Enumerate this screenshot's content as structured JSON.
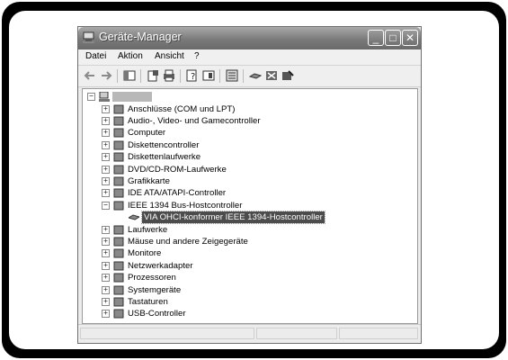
{
  "window": {
    "title": "Geräte-Manager",
    "buttons": {
      "minimize": "_",
      "maximize": "□",
      "close": "✕"
    }
  },
  "menu": [
    {
      "label": "Datei"
    },
    {
      "label": "Aktion"
    },
    {
      "label": "Ansicht"
    },
    {
      "label": "?"
    }
  ],
  "toolbar": {
    "icons": [
      "back-arrow-icon",
      "forward-arrow-icon",
      "console-tree-icon",
      "properties-icon",
      "print-icon",
      "help-icon",
      "view-icon",
      "scan-hardware-icon",
      "update-driver-icon",
      "uninstall-icon",
      "disable-icon"
    ]
  },
  "tree": {
    "root": {
      "label": ""
    },
    "categories": [
      {
        "label": "Anschlüsse (COM und LPT)",
        "icon": "port-icon",
        "expanded": false
      },
      {
        "label": "Audio-, Video- und Gamecontroller",
        "icon": "audio-icon",
        "expanded": false
      },
      {
        "label": "Computer",
        "icon": "computer-icon",
        "expanded": false
      },
      {
        "label": "Diskettencontroller",
        "icon": "floppy-controller-icon",
        "expanded": false
      },
      {
        "label": "Diskettenlaufwerke",
        "icon": "floppy-drive-icon",
        "expanded": false
      },
      {
        "label": "DVD/CD-ROM-Laufwerke",
        "icon": "cdrom-icon",
        "expanded": false
      },
      {
        "label": "Grafikkarte",
        "icon": "display-adapter-icon",
        "expanded": false
      },
      {
        "label": "IDE ATA/ATAPI-Controller",
        "icon": "ide-controller-icon",
        "expanded": false
      },
      {
        "label": "IEEE 1394 Bus-Hostcontroller",
        "icon": "ieee1394-icon",
        "expanded": true,
        "children": [
          {
            "label": "VIA OHCI-konformer IEEE 1394-Hostcontroller",
            "icon": "ieee1394-device-icon",
            "selected": true
          }
        ]
      },
      {
        "label": "Laufwerke",
        "icon": "disk-drive-icon",
        "expanded": false
      },
      {
        "label": "Mäuse und andere Zeigegeräte",
        "icon": "mouse-icon",
        "expanded": false
      },
      {
        "label": "Monitore",
        "icon": "monitor-icon",
        "expanded": false
      },
      {
        "label": "Netzwerkadapter",
        "icon": "network-adapter-icon",
        "expanded": false
      },
      {
        "label": "Prozessoren",
        "icon": "processor-icon",
        "expanded": false
      },
      {
        "label": "Systemgeräte",
        "icon": "system-device-icon",
        "expanded": false
      },
      {
        "label": "Tastaturen",
        "icon": "keyboard-icon",
        "expanded": false
      },
      {
        "label": "USB-Controller",
        "icon": "usb-icon",
        "expanded": false
      }
    ]
  }
}
